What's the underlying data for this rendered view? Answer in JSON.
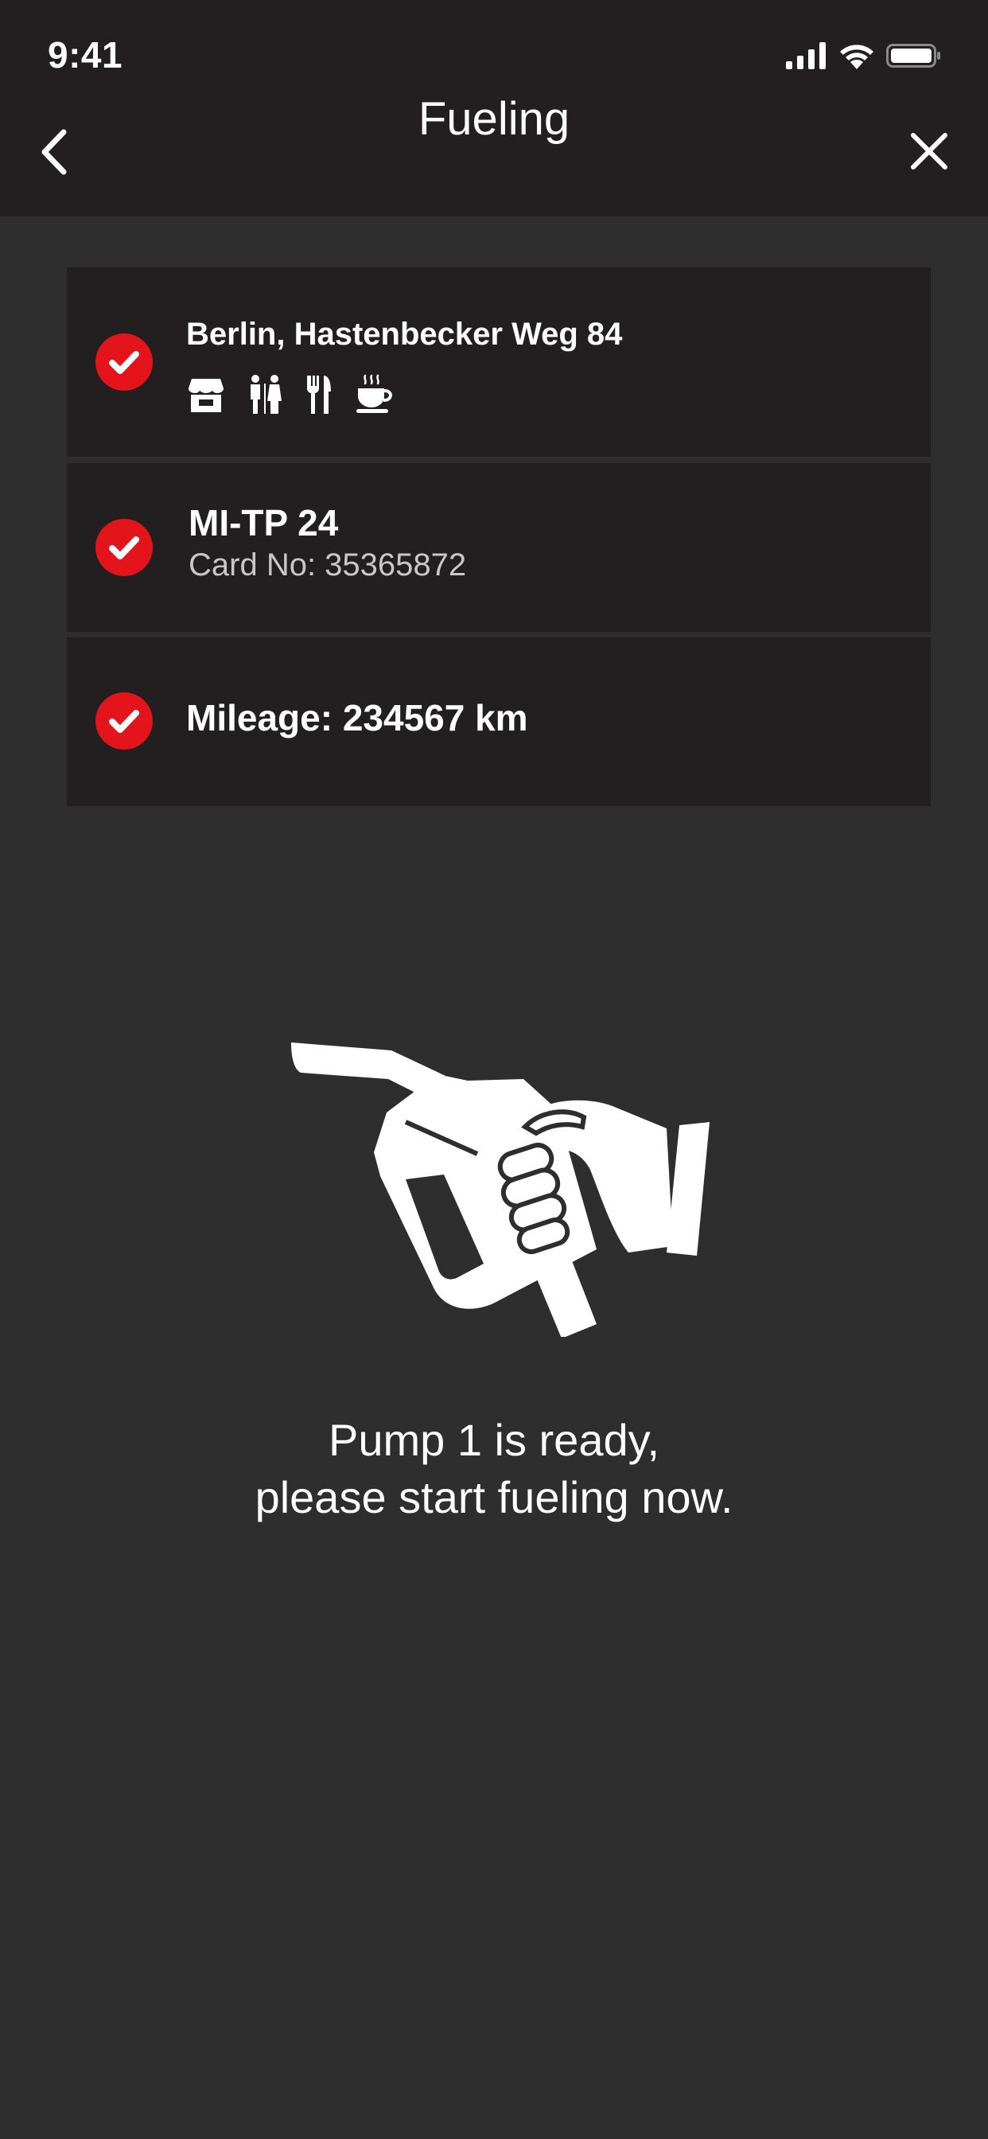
{
  "status_bar": {
    "time": "9:41"
  },
  "nav": {
    "title": "Fueling",
    "back_icon": "chevron-left-icon",
    "close_icon": "close-icon"
  },
  "station": {
    "name": "Berlin, Hastenbecker Weg 84",
    "amenities": [
      "shop-icon",
      "restroom-icon",
      "restaurant-icon",
      "coffee-icon"
    ]
  },
  "vehicle": {
    "plate": "MI-TP 24",
    "card": "Card No: 35365872"
  },
  "mileage": {
    "text": "Mileage: 234567 km"
  },
  "message": {
    "line1": "Pump 1 is ready,",
    "line2": "please start fueling now."
  },
  "colors": {
    "header_bg": "#231f20",
    "page_bg": "#2e2e2e",
    "card_bg": "#231f20",
    "accent_red": "#e3151a",
    "text_primary": "#ffffff",
    "text_secondary": "#c8c8c8"
  }
}
